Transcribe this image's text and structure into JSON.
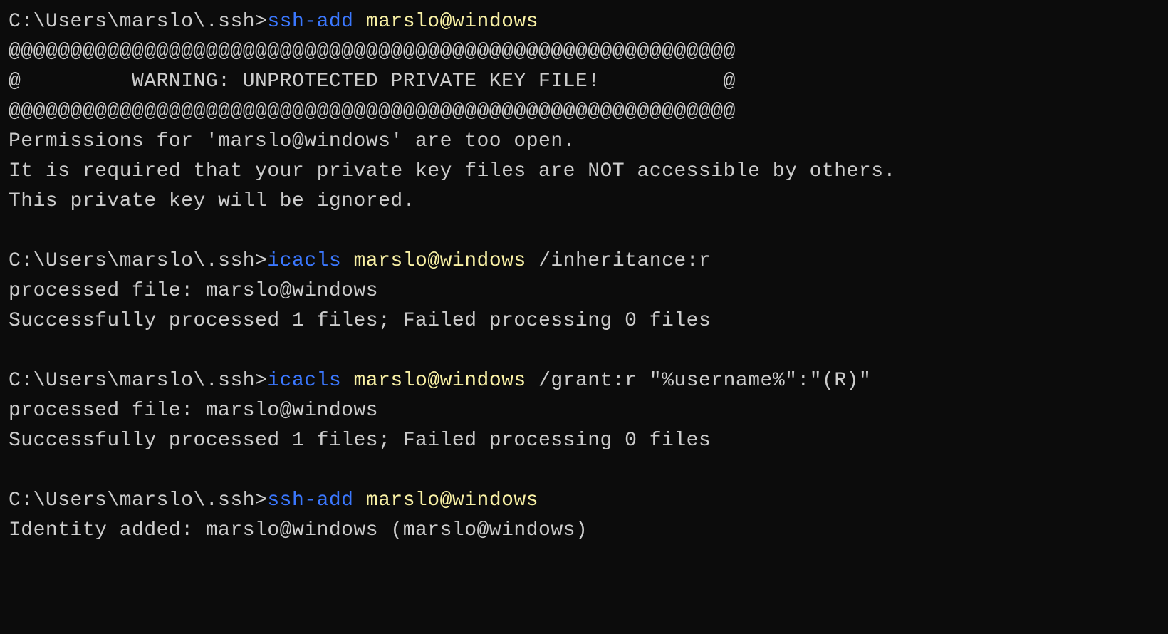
{
  "block1": {
    "prompt": "C:\\Users\\marslo\\.ssh>",
    "command": "ssh-add",
    "arg": "marslo@windows",
    "out1": "@@@@@@@@@@@@@@@@@@@@@@@@@@@@@@@@@@@@@@@@@@@@@@@@@@@@@@@@@@@",
    "out2": "@         WARNING: UNPROTECTED PRIVATE KEY FILE!          @",
    "out3": "@@@@@@@@@@@@@@@@@@@@@@@@@@@@@@@@@@@@@@@@@@@@@@@@@@@@@@@@@@@",
    "out4": "Permissions for 'marslo@windows' are too open.",
    "out5": "It is required that your private key files are NOT accessible by others.",
    "out6": "This private key will be ignored."
  },
  "block2": {
    "prompt": "C:\\Users\\marslo\\.ssh>",
    "command": "icacls",
    "arg1": "marslo@windows",
    "arg2": "/inheritance:r",
    "out1": "processed file: marslo@windows",
    "out2": "Successfully processed 1 files; Failed processing 0 files"
  },
  "block3": {
    "prompt": "C:\\Users\\marslo\\.ssh>",
    "command": "icacls",
    "arg1": "marslo@windows",
    "arg2": "/grant:r",
    "arg3": "\"%username%\":\"(R)\"",
    "out1": "processed file: marslo@windows",
    "out2": "Successfully processed 1 files; Failed processing 0 files"
  },
  "block4": {
    "prompt": "C:\\Users\\marslo\\.ssh>",
    "command": "ssh-add",
    "arg": "marslo@windows",
    "out1": "Identity added: marslo@windows (marslo@windows)"
  }
}
